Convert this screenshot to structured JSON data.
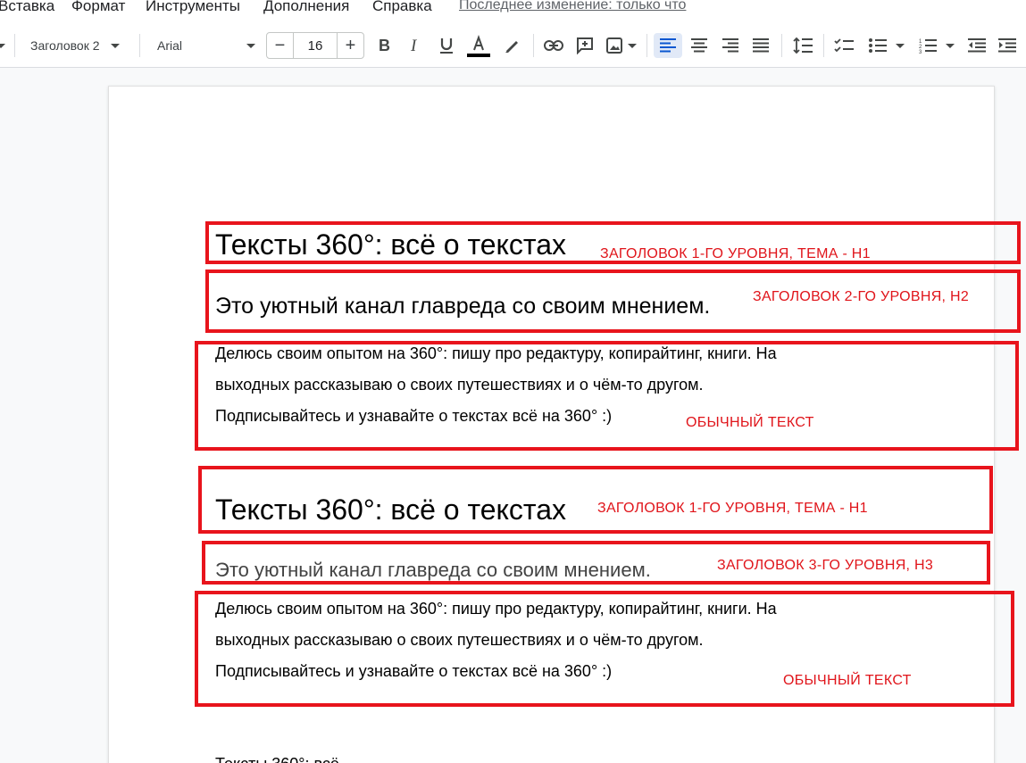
{
  "menu": {
    "items": [
      "Вставка",
      "Формат",
      "Инструменты",
      "Дополнения",
      "Справка"
    ],
    "last_edit": "Последнее изменение: только что"
  },
  "toolbar": {
    "style": "Заголовок 2",
    "font": "Arial",
    "font_size": "16",
    "minus": "−",
    "plus": "+"
  },
  "document": {
    "block1": {
      "h1": "Тексты 360°: всё о текстах",
      "h2": "Это уютный канал главреда со своим мнением.",
      "para": [
        "Делюсь своим опытом на 360°: пишу про редактуру, копирайтинг, книги. На",
        "выходных рассказываю о своих путешествиях и о чём-то другом.",
        "Подписывайтесь и узнавайте о текстах всё на 360° :)"
      ]
    },
    "block2": {
      "h1": "Тексты 360°: всё о текстах",
      "h3": "Это уютный канал главреда со своим мнением.",
      "para": [
        "Делюсь своим опытом на 360°: пишу про редактуру, копирайтинг, книги. На",
        "выходных рассказываю о своих путешествиях и о чём-то другом.",
        "Подписывайтесь и узнавайте о текстах всё на 360° :)"
      ]
    },
    "cut_line": "Тексты 360°: всё"
  },
  "annotations": {
    "n1": "ЗАГОЛОВОК 1-ГО УРОВНЯ, ТЕМА - H1",
    "n2": "ЗАГОЛОВОК 2-ГО УРОВНЯ, H2",
    "n3": "ОБЫЧНЫЙ ТЕКСТ",
    "n4": "ЗАГОЛОВОК 1-ГО УРОВНЯ, ТЕМА - H1",
    "n5": "ЗАГОЛОВОК 3-ГО УРОВНЯ, H3",
    "n6": "ОБЫЧНЫЙ ТЕКСТ"
  },
  "colors": {
    "annotation": "#e8141c",
    "active_align": "#e1e9f7",
    "text_color_bar": "#000000"
  }
}
